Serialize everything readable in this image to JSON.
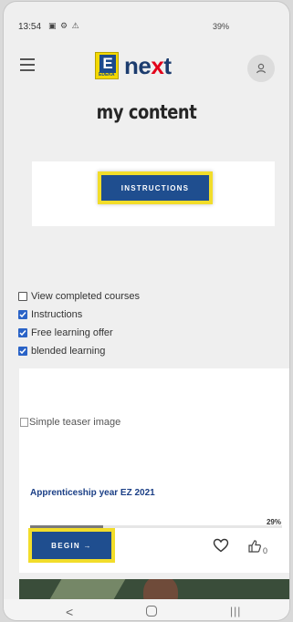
{
  "status": {
    "time": "13:54",
    "icons_left": "▣ ⚙ ⚠",
    "right_text": "39%"
  },
  "header": {
    "logo_letter": "E",
    "logo_sub": "EDEKA",
    "logo_text_a": "ne",
    "logo_text_x": "x",
    "logo_text_b": "t"
  },
  "page": {
    "title": "my content"
  },
  "instructions": {
    "button_label": "INSTRUCTIONS"
  },
  "filters": [
    {
      "label": "View completed courses",
      "checked": false
    },
    {
      "label": "Instructions",
      "checked": true
    },
    {
      "label": "Free learning offer",
      "checked": true
    },
    {
      "label": "blended learning",
      "checked": true
    }
  ],
  "course": {
    "teaser_alt": "Simple teaser image",
    "title": "Apprenticeship year EZ 2021",
    "progress_percent": 29,
    "progress_label": "29%",
    "begin_label": "BEGIN →",
    "like_count": "0"
  },
  "icons": {
    "menu": "hamburger-icon",
    "avatar": "user-icon",
    "heart": "heart-icon",
    "like": "thumbs-up-icon"
  },
  "colors": {
    "primary": "#1f4e8f",
    "highlight": "#f2dd2a",
    "title_blue": "#1b3f86"
  }
}
